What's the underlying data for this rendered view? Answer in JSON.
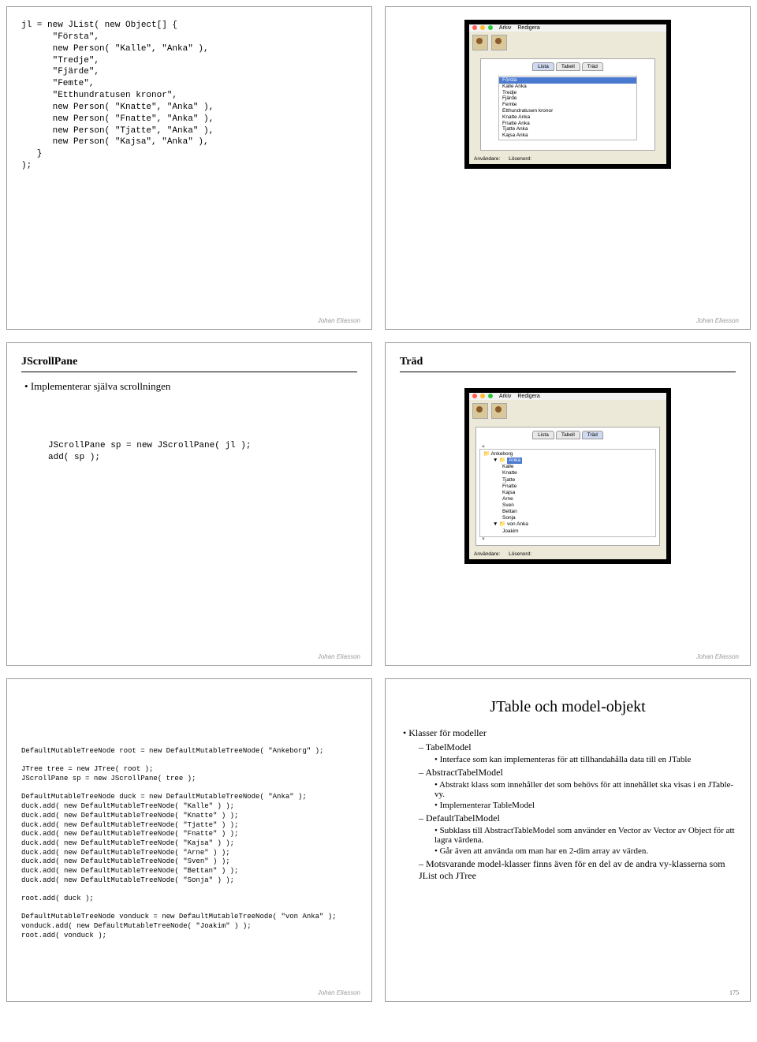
{
  "author": "Johan Eliasson",
  "page_number": "175",
  "slide1": {
    "code": "jl = new JList( new Object[] {\n      \"Första\",\n      new Person( \"Kalle\", \"Anka\" ),\n      \"Tredje\",\n      \"Fjärde\",\n      \"Femte\",\n      \"Etthundratusen kronor\",\n      new Person( \"Knatte\", \"Anka\" ),\n      new Person( \"Fnatte\", \"Anka\" ),\n      new Person( \"Tjatte\", \"Anka\" ),\n      new Person( \"Kajsa\", \"Anka\" ),\n   }\n);"
  },
  "slide2": {
    "menu": {
      "arkiv": "Arkiv",
      "redigera": "Redigera"
    },
    "tabs": {
      "lista": "Lista",
      "tabell": "Tabell",
      "trad": "Träd"
    },
    "list": [
      "Första",
      "Kalle Anka",
      "Tredje",
      "Fjärde",
      "Femte",
      "Etthundratusen kronor",
      "Knatte Anka",
      "Fnatte Anka",
      "Tjatte Anka",
      "Kajsa Anka"
    ],
    "status": {
      "anvandare": "Användare:",
      "losenord": "Lösenord:"
    }
  },
  "slide3": {
    "title": "JScrollPane",
    "bullet": "Implementerar själva scrollningen",
    "code": "JScrollPane sp = new JScrollPane( jl );\nadd( sp );"
  },
  "slide4": {
    "title": "Träd",
    "menu": {
      "arkiv": "Arkiv",
      "redigera": "Redigera"
    },
    "tabs": {
      "lista": "Lista",
      "tabell": "Tabell",
      "trad": "Träd"
    },
    "tree": {
      "root": "Ankeborg",
      "anka": "Anka",
      "anka_children": [
        "Kalle",
        "Knatte",
        "Tjatte",
        "Fnatte",
        "Kajsa",
        "Arne",
        "Sven",
        "Bettan",
        "Sonja"
      ],
      "vonanka": "von Anka",
      "vonanka_children": [
        "Joakim"
      ]
    },
    "status": {
      "anvandare": "Användare:",
      "losenord": "Lösenord:"
    }
  },
  "slide5": {
    "code": "DefaultMutableTreeNode root = new DefaultMutableTreeNode( \"Ankeborg\" );\n\nJTree tree = new JTree( root );\nJScrollPane sp = new JScrollPane( tree );\n\nDefaultMutableTreeNode duck = new DefaultMutableTreeNode( \"Anka\" );\nduck.add( new DefaultMutableTreeNode( \"Kalle\" ) );\nduck.add( new DefaultMutableTreeNode( \"Knatte\" ) );\nduck.add( new DefaultMutableTreeNode( \"Tjatte\" ) );\nduck.add( new DefaultMutableTreeNode( \"Fnatte\" ) );\nduck.add( new DefaultMutableTreeNode( \"Kajsa\" ) );\nduck.add( new DefaultMutableTreeNode( \"Arne\" ) );\nduck.add( new DefaultMutableTreeNode( \"Sven\" ) );\nduck.add( new DefaultMutableTreeNode( \"Bettan\" ) );\nduck.add( new DefaultMutableTreeNode( \"Sonja\" ) );\n\nroot.add( duck );\n\nDefaultMutableTreeNode vonduck = new DefaultMutableTreeNode( \"von Anka\" );\nvonduck.add( new DefaultMutableTreeNode( \"Joakim\" ) );\nroot.add( vonduck );"
  },
  "slide6": {
    "title": "JTable och model-objekt",
    "b1": "Klasser för modeller",
    "b2a": "TabelModel",
    "b3a": "Interface som kan implementeras för att tillhandahålla data till en JTable",
    "b2b": "AbstractTabelModel",
    "b3b": "Abstrakt klass som innehåller det som behövs för att innehållet ska visas i en JTable-vy.",
    "b3c": "Implementerar TableModel",
    "b2c": "DefaultTabelModel",
    "b3d": "Subklass till AbstractTableModel som använder en Vector av Vector av Object för att lagra värdena.",
    "b3e": "Går även att använda om man har en 2-dim array av värden.",
    "b2d": "Motsvarande model-klasser finns även för en del av de andra vy-klasserna som JList och JTree"
  }
}
